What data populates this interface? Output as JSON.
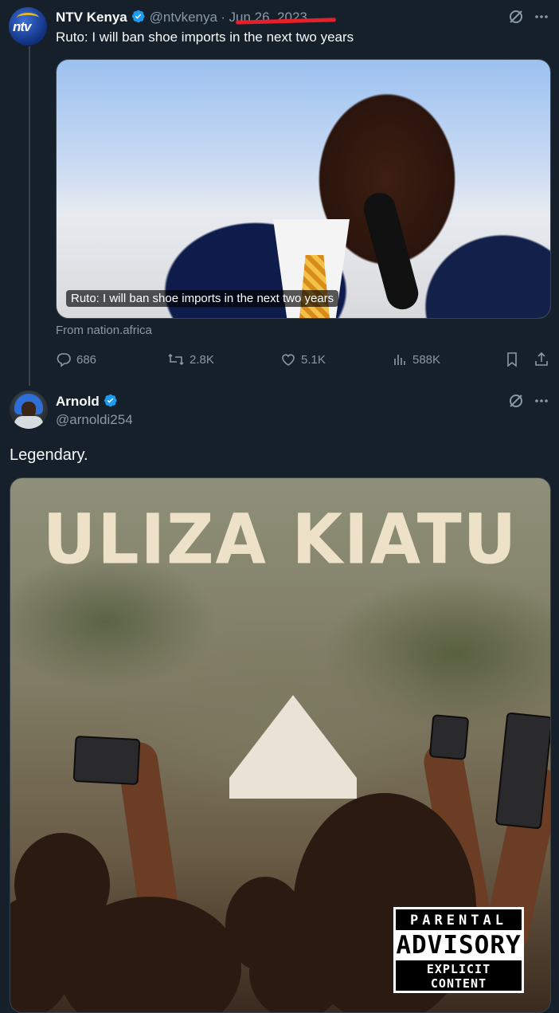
{
  "tweet1": {
    "name": "NTV Kenya",
    "handle": "@ntvkenya",
    "separator": "·",
    "date": "Jun 26, 2023",
    "text": "Ruto: I will ban shoe imports in the next two years",
    "card_caption": "Ruto: I will ban shoe imports in the next two years",
    "source": "From nation.africa",
    "stats": {
      "replies": "686",
      "retweets": "2.8K",
      "likes": "5.1K",
      "views": "588K"
    },
    "avatar_logo": "ntv"
  },
  "tweet2": {
    "name": "Arnold",
    "handle": "@arnoldi254",
    "text": "Legendary.",
    "album_title": "ULIZA KIATU",
    "advisory": {
      "line1": "PARENTAL",
      "line2": "ADVISORY",
      "line3": "EXPLICIT CONTENT"
    }
  },
  "colors": {
    "background": "#15202b",
    "verified": "#1d9bf0",
    "annotation": "#e5202a"
  }
}
